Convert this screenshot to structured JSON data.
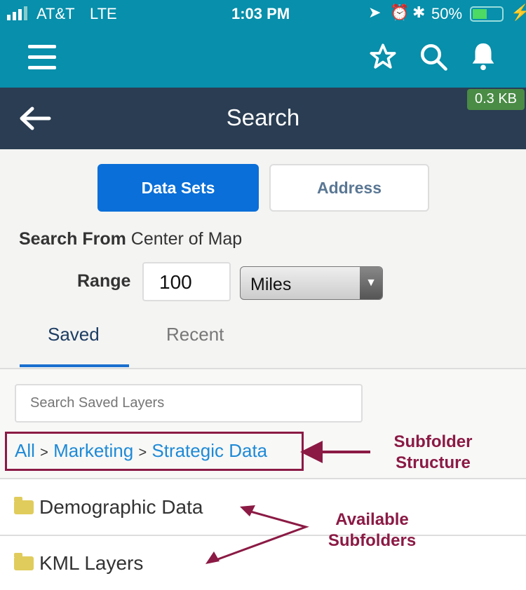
{
  "status_bar": {
    "carrier": "AT&T",
    "network": "LTE",
    "time": "1:03 PM",
    "battery": "50%",
    "battery_level": 0.5
  },
  "app_bar": {
    "icons": [
      "menu-icon",
      "star-icon",
      "search-icon",
      "bell-icon"
    ]
  },
  "header": {
    "title": "Search",
    "badge": "0.3 KB",
    "badge_color": "#4a8b45"
  },
  "mode": {
    "options": [
      "Data Sets",
      "Address"
    ],
    "selected": "Data Sets",
    "accent": "#0a6fd8"
  },
  "search_from": {
    "label": "Search From",
    "value": "Center of Map"
  },
  "range": {
    "label": "Range",
    "value": "100",
    "unit": "Miles"
  },
  "tabs": {
    "items": [
      "Saved",
      "Recent"
    ],
    "active": "Saved"
  },
  "saved_search": {
    "placeholder": "Search Saved Layers"
  },
  "breadcrumb": {
    "items": [
      "All",
      "Marketing",
      "Strategic Data"
    ],
    "separator": ">"
  },
  "folders": [
    "Demographic Data",
    "KML Layers"
  ],
  "annotations": {
    "structure": [
      "Subfolder",
      "Structure"
    ],
    "available": [
      "Available",
      "Subfolders"
    ],
    "color": "#8b1a44"
  }
}
